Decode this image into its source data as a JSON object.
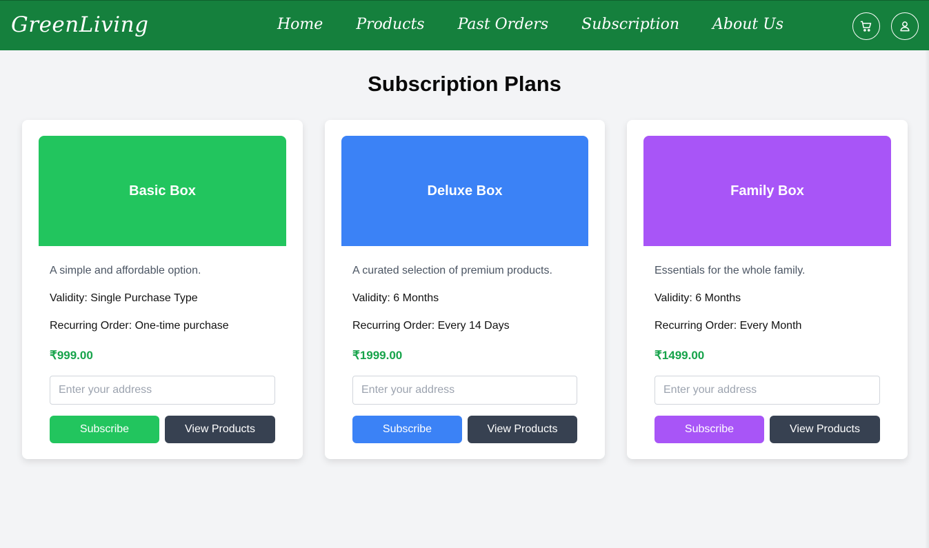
{
  "header": {
    "brand": "GreenLiving",
    "nav": [
      {
        "label": "Home"
      },
      {
        "label": "Products"
      },
      {
        "label": "Past Orders"
      },
      {
        "label": "Subscription"
      },
      {
        "label": "About Us"
      }
    ],
    "icons": [
      "cart-icon",
      "user-icon"
    ]
  },
  "page": {
    "title": "Subscription Plans"
  },
  "plans": [
    {
      "name": "Basic Box",
      "description": "A simple and affordable option.",
      "validity": "Validity: Single Purchase Type",
      "recurring": "Recurring Order: One-time purchase",
      "price": "₹999.00",
      "address_placeholder": "Enter your address",
      "address_value": "",
      "subscribe_label": "Subscribe",
      "view_label": "View Products",
      "color": "#22c55e"
    },
    {
      "name": "Deluxe Box",
      "description": "A curated selection of premium products.",
      "validity": "Validity: 6 Months",
      "recurring": "Recurring Order: Every 14 Days",
      "price": "₹1999.00",
      "address_placeholder": "Enter your address",
      "address_value": "",
      "subscribe_label": "Subscribe",
      "view_label": "View Products",
      "color": "#3b82f6"
    },
    {
      "name": "Family Box",
      "description": "Essentials for the whole family.",
      "validity": "Validity: 6 Months",
      "recurring": "Recurring Order: Every Month",
      "price": "₹1499.00",
      "address_placeholder": "Enter your address",
      "address_value": "",
      "subscribe_label": "Subscribe",
      "view_label": "View Products",
      "color": "#a855f7"
    }
  ],
  "colors": {
    "header_bg": "#15803d",
    "page_bg": "#f3f4f6",
    "price": "#16a34a",
    "view_button": "#374151"
  }
}
